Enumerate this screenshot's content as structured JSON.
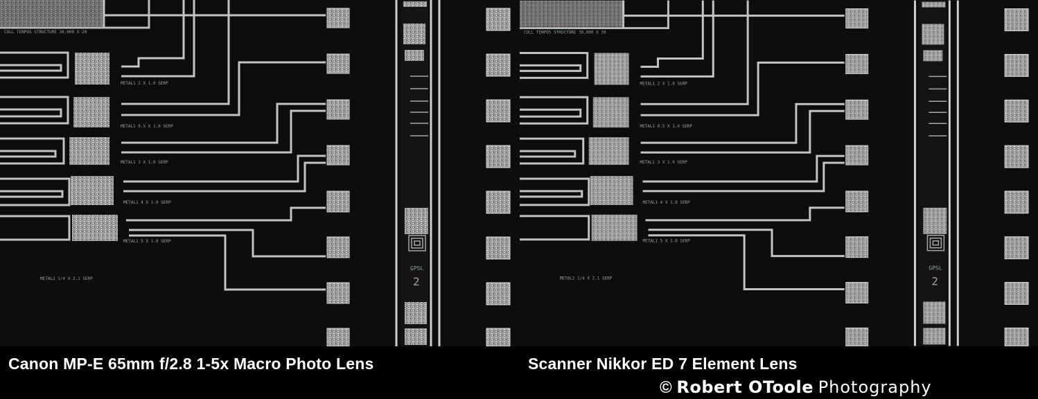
{
  "images": [
    {
      "caption": "Canon MP-E 65mm f/2.8 1-5x Macro Photo Lens",
      "subject": "microchip test structure photomicrograph"
    },
    {
      "caption": "Scanner Nikkor ED 7 Element Lens",
      "subject": "microchip test structure photomicrograph"
    }
  ],
  "copyright": {
    "symbol": "©",
    "name": "Robert OToole",
    "studio": "Photography"
  },
  "colors": {
    "background": "#000000",
    "chip_background": "#0e0c0d",
    "metal": "#b9b9b9",
    "caption_text": "#ffffff"
  }
}
